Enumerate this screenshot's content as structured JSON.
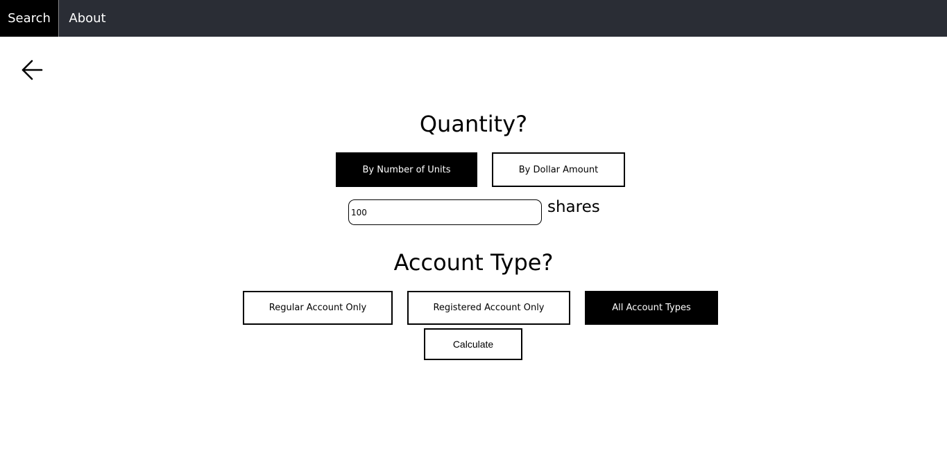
{
  "nav": {
    "items": [
      {
        "label": "Search",
        "active": true
      },
      {
        "label": "About",
        "active": false
      }
    ]
  },
  "quantity": {
    "heading": "Quantity?",
    "options": [
      {
        "label": "By Number of Units",
        "selected": true
      },
      {
        "label": "By Dollar Amount",
        "selected": false
      }
    ],
    "input_value": "100",
    "unit_label": "shares"
  },
  "account": {
    "heading": "Account Type?",
    "options": [
      {
        "label": "Regular Account Only",
        "selected": false
      },
      {
        "label": "Registered Account Only",
        "selected": false
      },
      {
        "label": "All Account Types",
        "selected": true
      }
    ]
  },
  "calculate_label": "Calculate",
  "icons": {
    "back": "arrow-left-icon"
  },
  "colors": {
    "nav_bg": "#2a2d35",
    "active": "#000000"
  }
}
